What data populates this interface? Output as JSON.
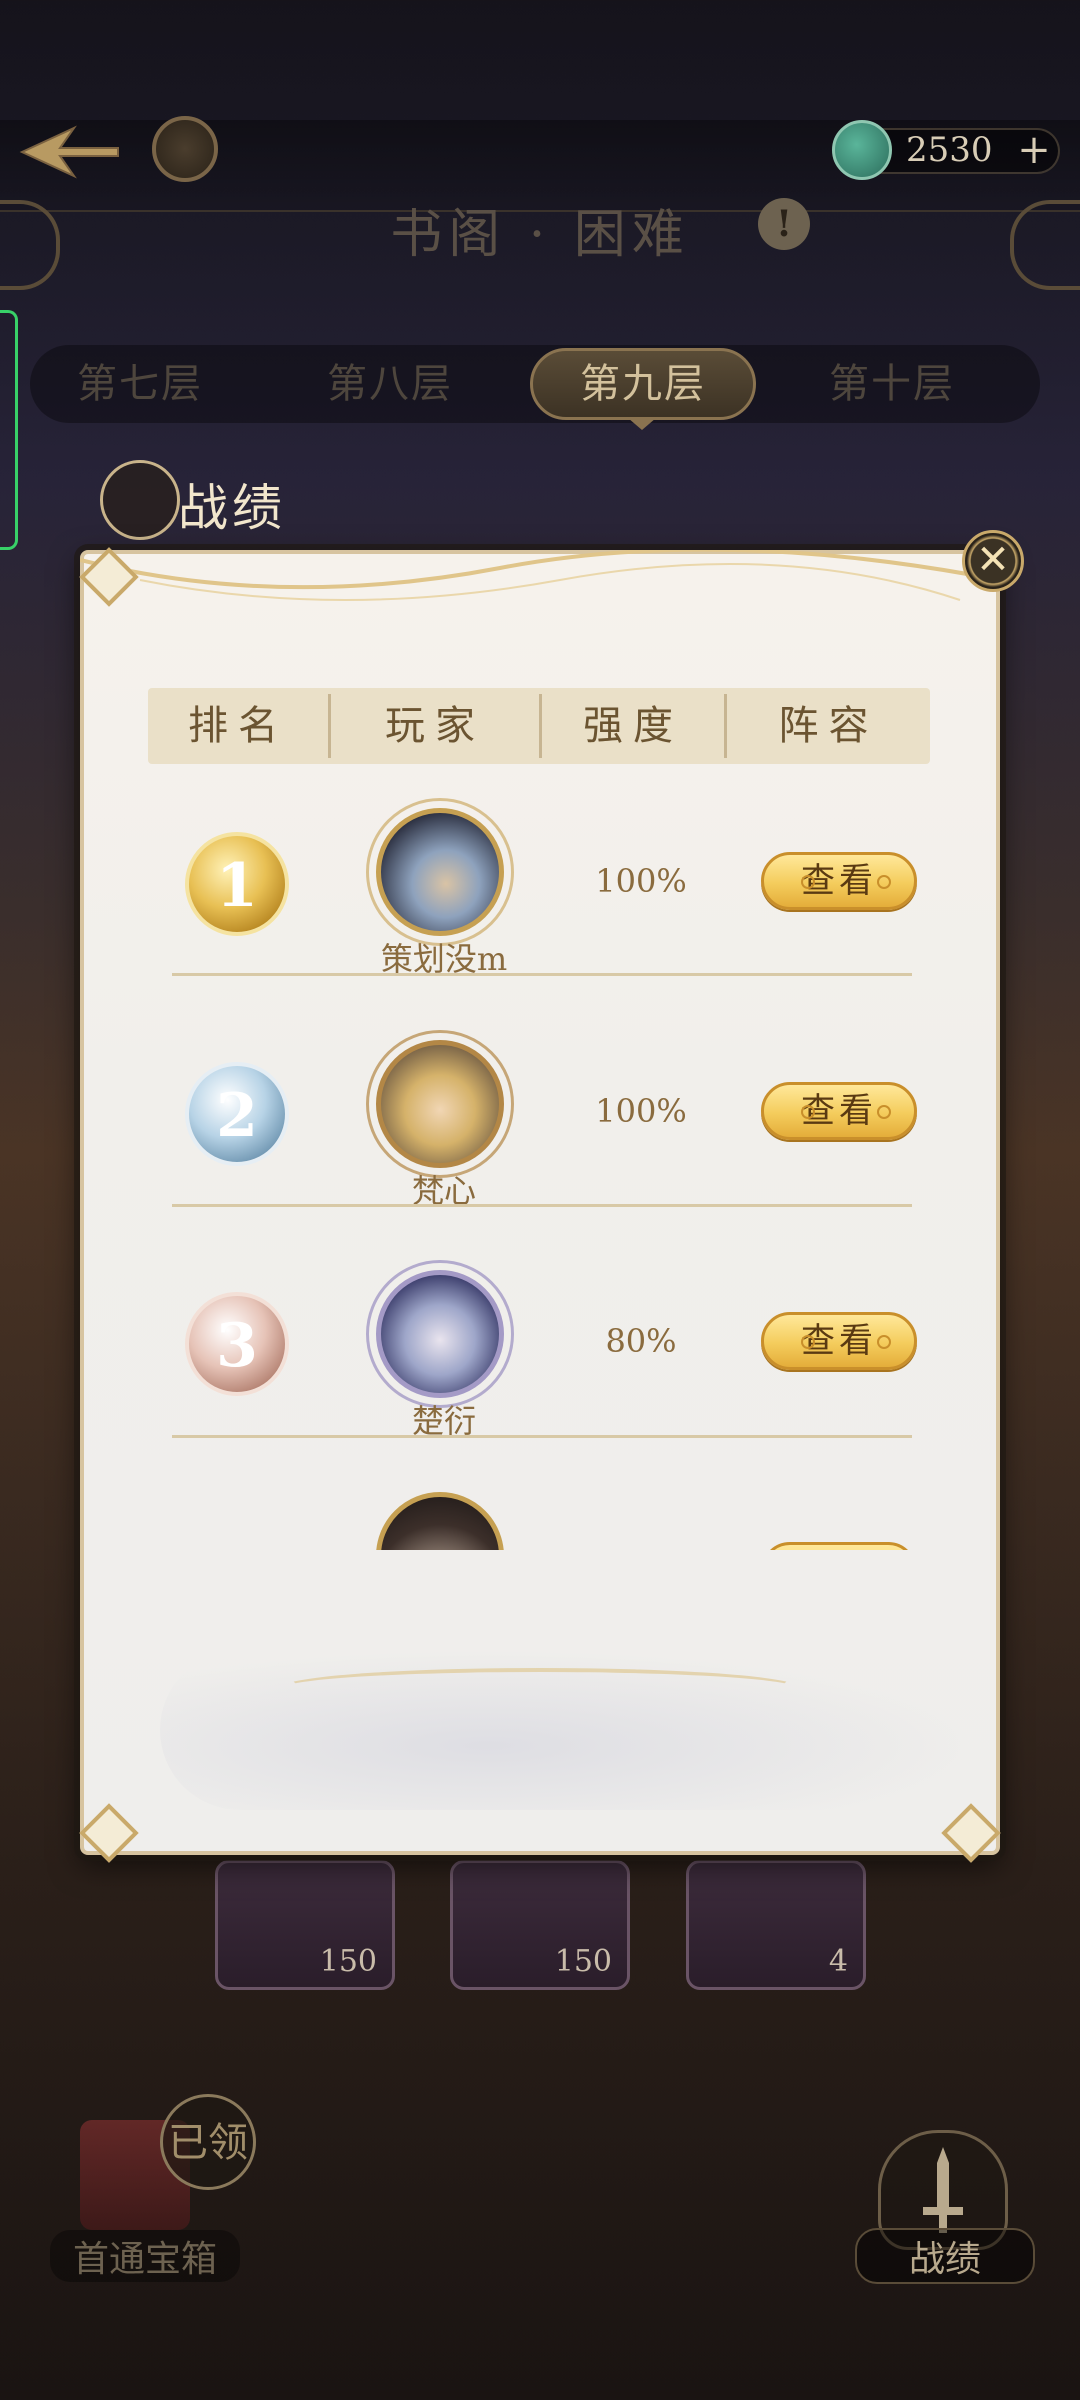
{
  "header": {
    "title": "书阁 · 困难",
    "currency_value": "2530",
    "currency_plus": "+",
    "info_symbol": "!"
  },
  "floor_tabs": [
    {
      "label": "第七层",
      "active": false
    },
    {
      "label": "第八层",
      "active": false
    },
    {
      "label": "第九层",
      "active": true
    },
    {
      "label": "第十层",
      "active": false
    }
  ],
  "section_title": "战绩",
  "modal": {
    "close_symbol": "✕",
    "columns": [
      "排名",
      "玩家",
      "强度",
      "阵容"
    ],
    "rows": [
      {
        "rank": "1",
        "medal": "gold",
        "player": "策划没m",
        "strength": "100%",
        "action": "查看"
      },
      {
        "rank": "2",
        "medal": "silver",
        "player": "梵心",
        "strength": "100%",
        "action": "查看"
      },
      {
        "rank": "3",
        "medal": "bronze",
        "player": "楚衍",
        "strength": "80%",
        "action": "查看"
      }
    ]
  },
  "rewards": [
    {
      "count": "150"
    },
    {
      "count": "150"
    },
    {
      "count": "4"
    }
  ],
  "bottom": {
    "chest_label": "首通宝箱",
    "chest_badge": "已领",
    "record_label": "战绩"
  }
}
